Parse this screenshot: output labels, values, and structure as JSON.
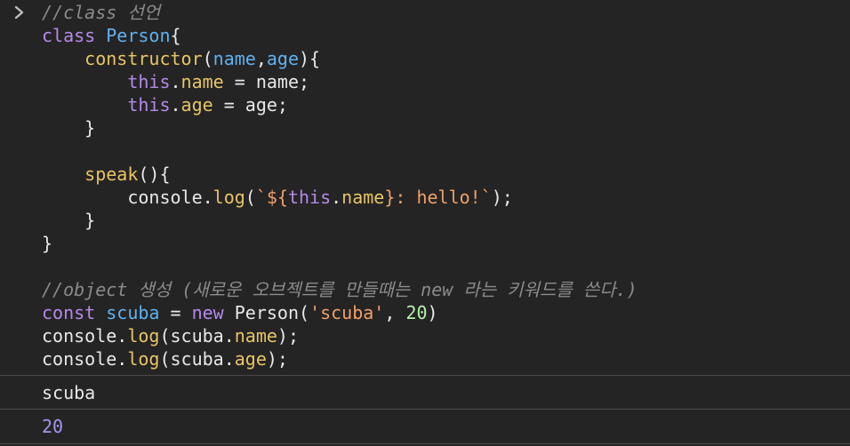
{
  "console": {
    "prompt_icon": "chevron-right-icon",
    "input_lines": [
      [
        {
          "t": "comment",
          "v": "//class 선언"
        }
      ],
      [
        {
          "t": "kw",
          "v": "class "
        },
        {
          "t": "cls",
          "v": "Person"
        },
        {
          "t": "plain",
          "v": "{"
        }
      ],
      [
        {
          "t": "plain",
          "v": "    "
        },
        {
          "t": "fn",
          "v": "constructor"
        },
        {
          "t": "plain",
          "v": "("
        },
        {
          "t": "param",
          "v": "name"
        },
        {
          "t": "plain",
          "v": ","
        },
        {
          "t": "param",
          "v": "age"
        },
        {
          "t": "plain",
          "v": "){"
        }
      ],
      [
        {
          "t": "plain",
          "v": "        "
        },
        {
          "t": "kw",
          "v": "this"
        },
        {
          "t": "plain",
          "v": "."
        },
        {
          "t": "prop",
          "v": "name"
        },
        {
          "t": "plain",
          "v": " = name;"
        }
      ],
      [
        {
          "t": "plain",
          "v": "        "
        },
        {
          "t": "kw",
          "v": "this"
        },
        {
          "t": "plain",
          "v": "."
        },
        {
          "t": "prop",
          "v": "age"
        },
        {
          "t": "plain",
          "v": " = age;"
        }
      ],
      [
        {
          "t": "plain",
          "v": "    }"
        }
      ],
      [
        {
          "t": "plain",
          "v": ""
        }
      ],
      [
        {
          "t": "plain",
          "v": "    "
        },
        {
          "t": "fn",
          "v": "speak"
        },
        {
          "t": "plain",
          "v": "(){"
        }
      ],
      [
        {
          "t": "plain",
          "v": "        console."
        },
        {
          "t": "fn",
          "v": "log"
        },
        {
          "t": "plain",
          "v": "("
        },
        {
          "t": "str",
          "v": "`${"
        },
        {
          "t": "kw",
          "v": "this"
        },
        {
          "t": "plain",
          "v": "."
        },
        {
          "t": "prop",
          "v": "name"
        },
        {
          "t": "str",
          "v": "}: hello!`"
        },
        {
          "t": "plain",
          "v": ");"
        }
      ],
      [
        {
          "t": "plain",
          "v": "    }"
        }
      ],
      [
        {
          "t": "plain",
          "v": "}"
        }
      ],
      [
        {
          "t": "plain",
          "v": ""
        }
      ],
      [
        {
          "t": "comment",
          "v": "//object 생성 (새로운 오브젝트를 만들때는 new 라는 키워드를 쓴다.)"
        }
      ],
      [
        {
          "t": "kw",
          "v": "const "
        },
        {
          "t": "cls",
          "v": "scuba"
        },
        {
          "t": "plain",
          "v": " = "
        },
        {
          "t": "kw",
          "v": "new "
        },
        {
          "t": "plain",
          "v": "Person("
        },
        {
          "t": "str",
          "v": "'scuba'"
        },
        {
          "t": "plain",
          "v": ", "
        },
        {
          "t": "num",
          "v": "20"
        },
        {
          "t": "plain",
          "v": ")"
        }
      ],
      [
        {
          "t": "plain",
          "v": "console."
        },
        {
          "t": "fn",
          "v": "log"
        },
        {
          "t": "plain",
          "v": "(scuba."
        },
        {
          "t": "prop",
          "v": "name"
        },
        {
          "t": "plain",
          "v": ");"
        }
      ],
      [
        {
          "t": "plain",
          "v": "console."
        },
        {
          "t": "fn",
          "v": "log"
        },
        {
          "t": "plain",
          "v": "(scuba."
        },
        {
          "t": "prop",
          "v": "age"
        },
        {
          "t": "plain",
          "v": ");"
        }
      ]
    ],
    "outputs": [
      {
        "kind": "string",
        "value": "scuba"
      },
      {
        "kind": "number",
        "value": "20"
      }
    ]
  }
}
